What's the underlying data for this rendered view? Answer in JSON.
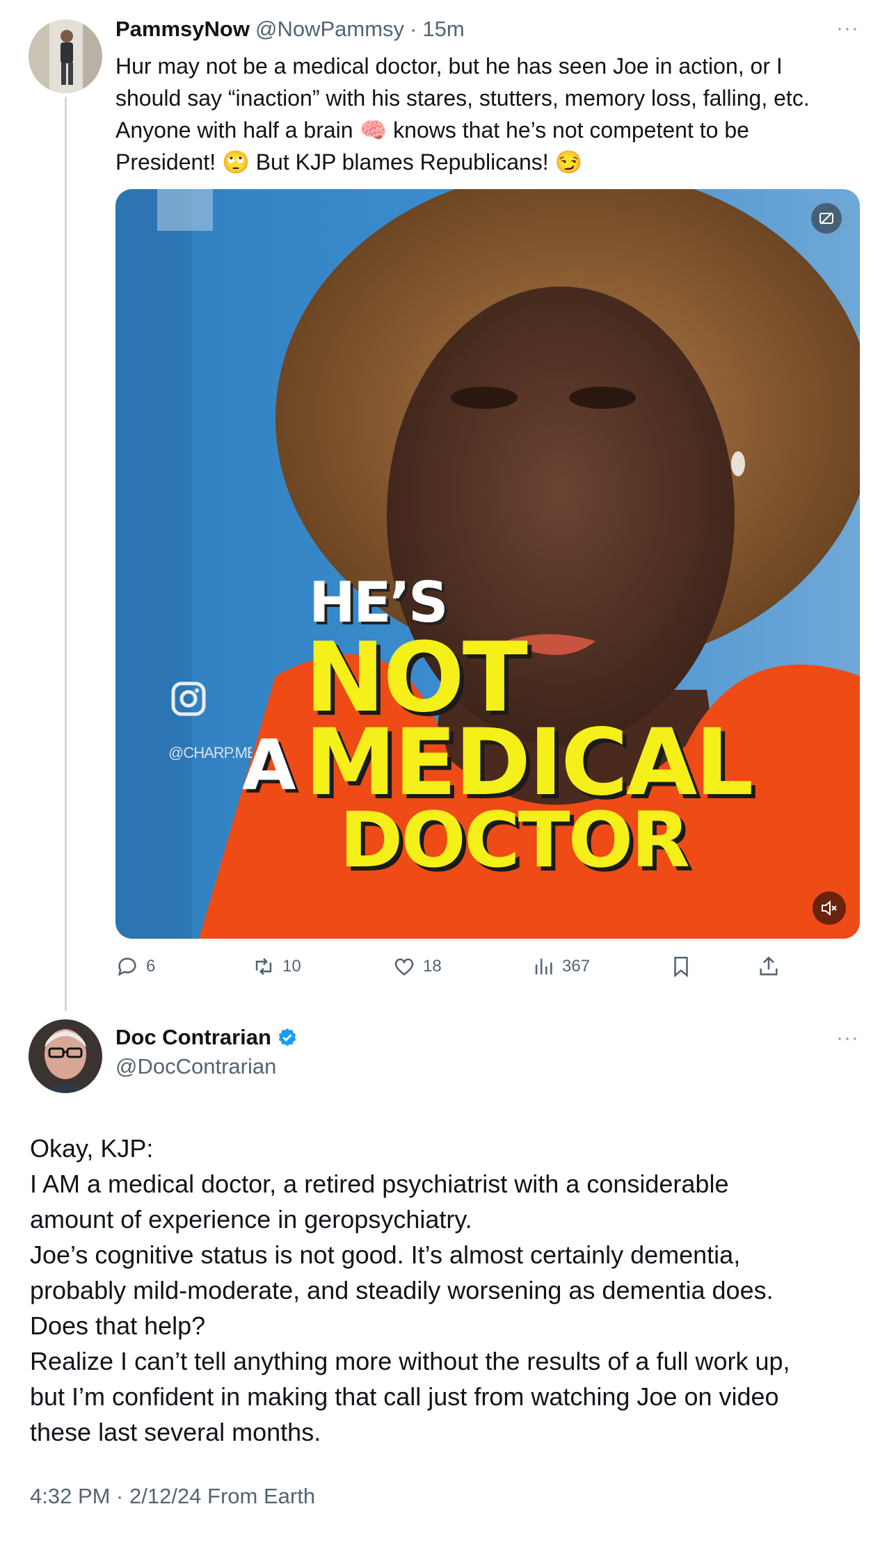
{
  "parent_tweet": {
    "display_name": "PammsyNow",
    "handle": "@NowPammsy",
    "time": "15m",
    "text_lines": [
      "Hur may not be a medical doctor, but he has seen Joe in action, or I",
      "should say “inaction” with his stares, stutters, memory loss, falling, etc.",
      "Anyone with half a brain 🧠 knows that he’s not competent to be",
      "President! 🙄 But KJP blames Republicans! 😏"
    ],
    "media": {
      "caption_line1": "HE’S",
      "caption_line2": "NOT",
      "caption_line3a": "A",
      "caption_line3b": "MEDICAL",
      "caption_line4": "DOCTOR",
      "watermark": "@CHARP.MEDIA"
    },
    "actions": {
      "replies": "6",
      "reposts": "10",
      "likes": "18",
      "views": "367"
    }
  },
  "main_tweet": {
    "display_name": "Doc Contrarian",
    "handle": "@DocContrarian",
    "text_lines": [
      "Okay, KJP:",
      "I AM a medical doctor, a retired psychiatrist with a considerable",
      "amount of experience in geropsychiatry.",
      "Joe’s cognitive status is not good. It’s almost certainly dementia,",
      "probably mild-moderate, and steadily worsening as dementia does.",
      "Does that help?",
      "Realize I can’t tell anything more without the results of a full work up,",
      "but I’m confident in making that call just from watching Joe on video",
      "these last several months."
    ],
    "timestamp": "4:32 PM · 2/12/24 From Earth"
  },
  "colors": {
    "accent": "#1d9bf0",
    "secondary_text": "#536471",
    "thread_line": "#cfd9de"
  },
  "icons": [
    "more-icon",
    "reply-icon",
    "repost-icon",
    "like-icon",
    "views-icon",
    "bookmark-icon",
    "share-icon",
    "verified-icon",
    "instagram-icon",
    "mute-icon",
    "captions-icon"
  ]
}
